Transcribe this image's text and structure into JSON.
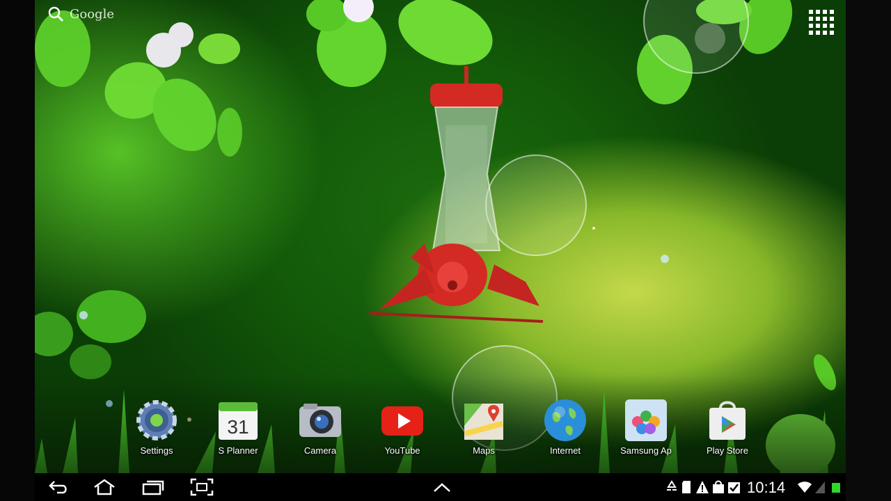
{
  "search": {
    "label": "Google"
  },
  "apps_button": {
    "icon": "apps-grid-icon"
  },
  "dock": {
    "apps": [
      {
        "label": "Settings",
        "icon": "settings-gear-icon"
      },
      {
        "label": "S Planner",
        "icon": "calendar-icon",
        "badge": "31"
      },
      {
        "label": "Camera",
        "icon": "camera-icon"
      },
      {
        "label": "YouTube",
        "icon": "youtube-play-icon"
      },
      {
        "label": "Maps",
        "icon": "maps-pin-icon"
      },
      {
        "label": "Internet",
        "icon": "globe-icon"
      },
      {
        "label": "Samsung Ap",
        "icon": "samsung-apps-icon"
      },
      {
        "label": "Play Store",
        "icon": "play-store-bag-icon"
      }
    ]
  },
  "navbar": {
    "buttons": [
      "back-icon",
      "home-icon",
      "recent-apps-icon",
      "screenshot-capture-icon",
      "chevron-up-icon"
    ],
    "clock": "10:14",
    "status_icons": [
      "recycle-icon",
      "sd-card-icon",
      "warning-icon",
      "shopping-bag-icon",
      "checkbox-icon",
      "wifi-icon",
      "signal-icon",
      "battery-icon"
    ]
  },
  "colors": {
    "wallpaper_dark": "#0b3d06",
    "wallpaper_light": "#c4d94a",
    "feeder_red": "#d42a24",
    "youtube_red": "#e62117",
    "status_green": "#31d62d"
  }
}
